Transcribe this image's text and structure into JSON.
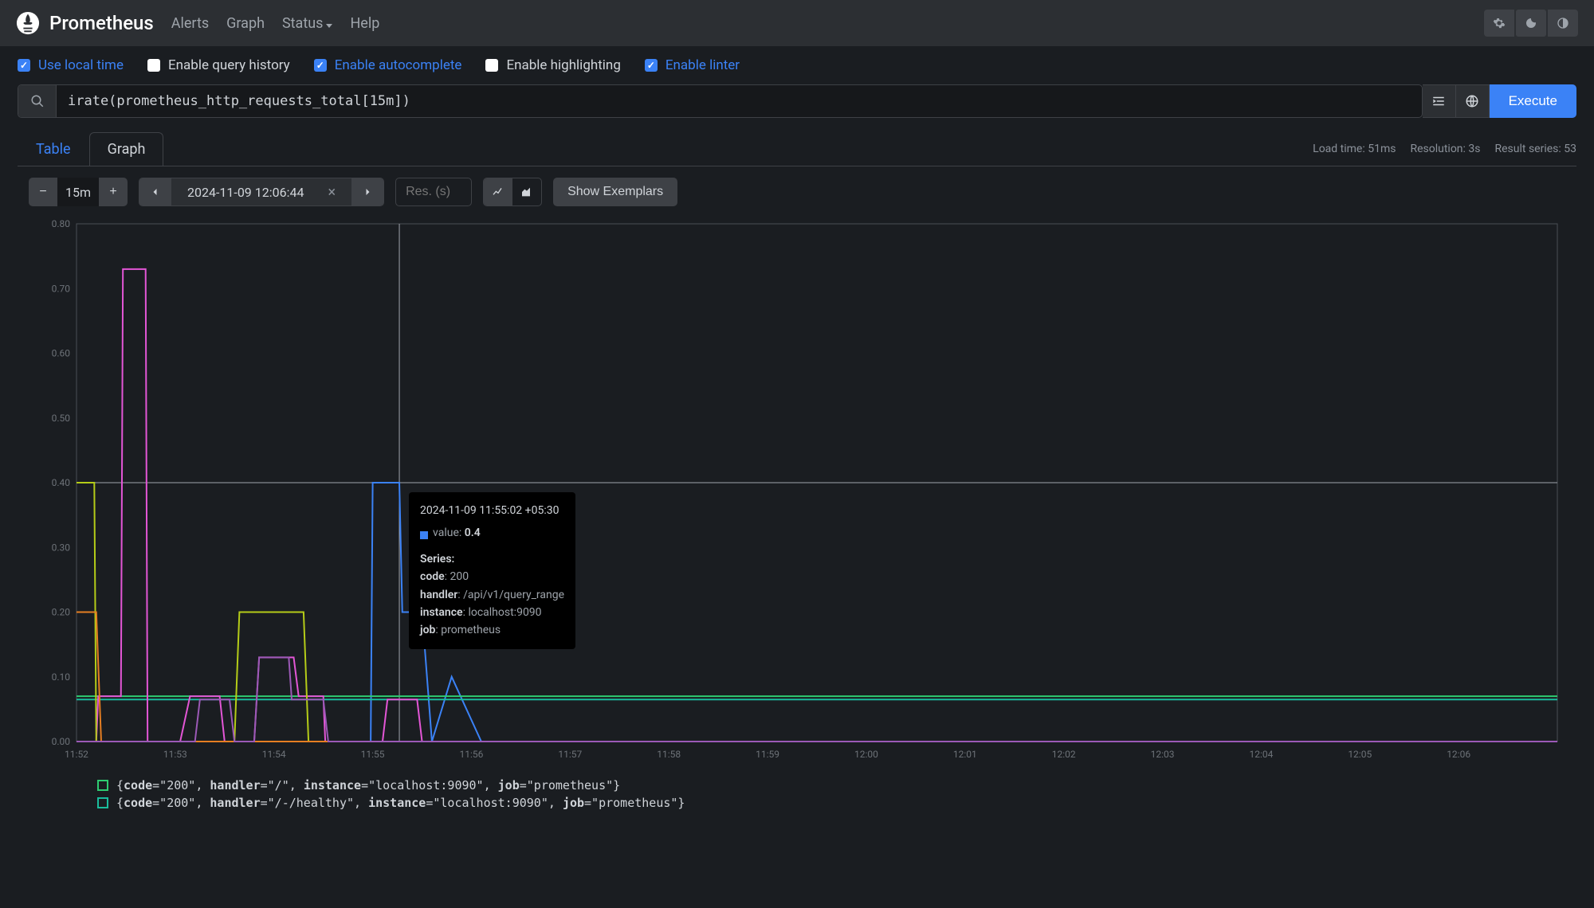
{
  "nav": {
    "brand": "Prometheus",
    "links": {
      "alerts": "Alerts",
      "graph": "Graph",
      "status": "Status",
      "help": "Help"
    }
  },
  "options": {
    "local_time": "Use local time",
    "query_history": "Enable query history",
    "autocomplete": "Enable autocomplete",
    "highlighting": "Enable highlighting",
    "linter": "Enable linter"
  },
  "query": "irate(prometheus_http_requests_total[15m])",
  "execute": "Execute",
  "tabs": {
    "table": "Table",
    "graph": "Graph"
  },
  "stats": {
    "load": "Load time: 51ms",
    "res": "Resolution: 3s",
    "series": "Result series: 53"
  },
  "toolbar": {
    "range": "15m",
    "time": "2024-11-09 12:06:44",
    "res_placeholder": "Res. (s)",
    "exemplars": "Show Exemplars"
  },
  "tooltip": {
    "ts": "2024-11-09 11:55:02 +05:30",
    "value_label": "value: ",
    "value": "0.4",
    "series_label": "Series:",
    "code_k": "code",
    "code_v": ": 200",
    "handler_k": "handler",
    "handler_v": ": /api/v1/query_range",
    "instance_k": "instance",
    "instance_v": ": localhost:9090",
    "job_k": "job",
    "job_v": ": prometheus"
  },
  "legend": [
    {
      "color": "#2ecc71",
      "text": "{code=\"200\", handler=\"/\", instance=\"localhost:9090\", job=\"prometheus\"}"
    },
    {
      "color": "#1abc9c",
      "text": "{code=\"200\", handler=\"/-/healthy\", instance=\"localhost:9090\", job=\"prometheus\"}"
    }
  ],
  "chart_data": {
    "type": "line",
    "ylim": [
      0,
      0.8
    ],
    "y_ticks": [
      0.0,
      0.1,
      0.2,
      0.3,
      0.4,
      0.5,
      0.6,
      0.7,
      0.8
    ],
    "x_ticks": [
      "11:52",
      "11:53",
      "11:54",
      "11:55",
      "11:56",
      "11:57",
      "11:58",
      "11:59",
      "12:00",
      "12:01",
      "12:02",
      "12:03",
      "12:04",
      "12:05",
      "12:06"
    ],
    "x_range_minutes": [
      0,
      15
    ],
    "cursor_x_minute": 3.27,
    "series": [
      {
        "name": "code=200 handler=/api/v1/query_range",
        "color": "#3b82f6",
        "points": [
          [
            2.98,
            0.0
          ],
          [
            3.0,
            0.4
          ],
          [
            3.27,
            0.4
          ],
          [
            3.3,
            0.2
          ],
          [
            3.5,
            0.2
          ],
          [
            3.6,
            0.0
          ],
          [
            3.8,
            0.1
          ],
          [
            4.1,
            0.0
          ]
        ]
      },
      {
        "name": "code=200 handler=/",
        "color": "#2ecc71",
        "points": [
          [
            0.0,
            0.07
          ],
          [
            15.0,
            0.07
          ]
        ]
      },
      {
        "name": "code=200 handler=/-/healthy",
        "color": "#1abc9c",
        "points": [
          [
            0.0,
            0.065
          ],
          [
            15.0,
            0.065
          ]
        ]
      },
      {
        "name": "series-magenta",
        "color": "#e356d6",
        "points": [
          [
            0.0,
            0.0
          ],
          [
            0.2,
            0.0
          ],
          [
            0.22,
            0.07
          ],
          [
            0.45,
            0.07
          ],
          [
            0.47,
            0.73
          ],
          [
            0.7,
            0.73
          ],
          [
            0.72,
            0.0
          ],
          [
            1.05,
            0.0
          ],
          [
            1.15,
            0.07
          ],
          [
            1.45,
            0.07
          ],
          [
            1.5,
            0.0
          ],
          [
            1.8,
            0.0
          ],
          [
            1.85,
            0.13
          ],
          [
            2.2,
            0.13
          ],
          [
            2.25,
            0.07
          ],
          [
            2.5,
            0.07
          ],
          [
            2.52,
            0.0
          ],
          [
            3.1,
            0.0
          ],
          [
            3.15,
            0.065
          ],
          [
            3.45,
            0.065
          ],
          [
            3.5,
            0.0
          ],
          [
            15.0,
            0.0
          ]
        ]
      },
      {
        "name": "series-yellowgreen",
        "color": "#b5cc18",
        "points": [
          [
            0.0,
            0.4
          ],
          [
            0.18,
            0.4
          ],
          [
            0.2,
            0.0
          ],
          [
            1.6,
            0.0
          ],
          [
            1.65,
            0.2
          ],
          [
            2.3,
            0.2
          ],
          [
            2.35,
            0.0
          ],
          [
            15.0,
            0.0
          ]
        ]
      },
      {
        "name": "series-orange",
        "color": "#e67e22",
        "points": [
          [
            0.0,
            0.2
          ],
          [
            0.2,
            0.2
          ],
          [
            0.25,
            0.0
          ],
          [
            15.0,
            0.0
          ]
        ]
      },
      {
        "name": "series-violet",
        "color": "#9b59b6",
        "points": [
          [
            0.0,
            0.0
          ],
          [
            1.2,
            0.0
          ],
          [
            1.25,
            0.065
          ],
          [
            1.55,
            0.065
          ],
          [
            1.6,
            0.0
          ],
          [
            1.8,
            0.0
          ],
          [
            1.85,
            0.13
          ],
          [
            2.15,
            0.13
          ],
          [
            2.18,
            0.065
          ],
          [
            2.5,
            0.065
          ],
          [
            2.55,
            0.0
          ],
          [
            15.0,
            0.0
          ]
        ]
      }
    ]
  }
}
